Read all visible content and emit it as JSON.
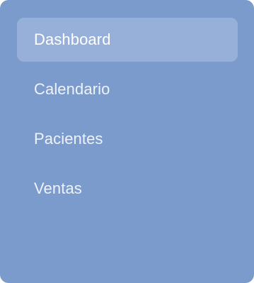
{
  "sidebar": {
    "items": [
      {
        "label": "Dashboard",
        "active": true
      },
      {
        "label": "Calendario",
        "active": false
      },
      {
        "label": "Pacientes",
        "active": false
      },
      {
        "label": "Ventas",
        "active": false
      }
    ]
  },
  "colors": {
    "sidebar_bg": "#7b9bcc",
    "active_item_bg": "#97b0d9",
    "active_text": "#ffffff",
    "item_text": "#eef2fa"
  }
}
